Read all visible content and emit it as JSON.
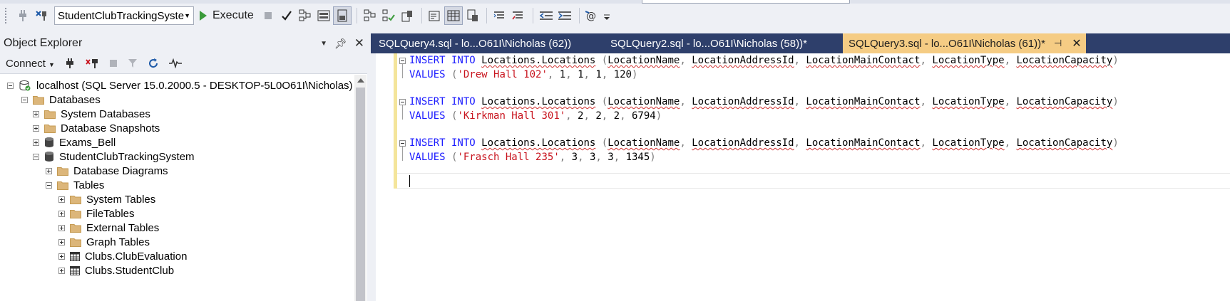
{
  "toolbar": {
    "database_selected": "StudentClubTrackingSystem",
    "execute_label": "Execute"
  },
  "object_explorer": {
    "title": "Object Explorer",
    "connect_label": "Connect",
    "tree": [
      {
        "label": "localhost (SQL Server 15.0.2000.5 - DESKTOP-5L0O61I\\Nicholas)",
        "icon": "server-icon",
        "expander": "minus"
      },
      {
        "label": "Databases",
        "icon": "folder-icon",
        "expander": "minus"
      },
      {
        "label": "System Databases",
        "icon": "folder-icon",
        "expander": "plus"
      },
      {
        "label": "Database Snapshots",
        "icon": "folder-icon",
        "expander": "plus"
      },
      {
        "label": "Exams_Bell",
        "icon": "database-icon",
        "expander": "plus"
      },
      {
        "label": "StudentClubTrackingSystem",
        "icon": "database-icon",
        "expander": "minus"
      },
      {
        "label": "Database Diagrams",
        "icon": "folder-icon",
        "expander": "plus"
      },
      {
        "label": "Tables",
        "icon": "folder-icon",
        "expander": "minus"
      },
      {
        "label": "System Tables",
        "icon": "folder-icon",
        "expander": "plus"
      },
      {
        "label": "FileTables",
        "icon": "folder-icon",
        "expander": "plus"
      },
      {
        "label": "External Tables",
        "icon": "folder-icon",
        "expander": "plus"
      },
      {
        "label": "Graph Tables",
        "icon": "folder-icon",
        "expander": "plus"
      },
      {
        "label": "Clubs.ClubEvaluation",
        "icon": "table-icon",
        "expander": "plus"
      },
      {
        "label": "Clubs.StudentClub",
        "icon": "table-icon",
        "expander": "plus"
      }
    ]
  },
  "tabs": [
    {
      "label": "SQLQuery4.sql - lo...O61I\\Nicholas (62))",
      "active": false
    },
    {
      "label": "SQLQuery2.sql - lo...O61I\\Nicholas (58))*",
      "active": false
    },
    {
      "label": "SQLQuery3.sql - lo...O61I\\Nicholas (61))*",
      "active": true
    }
  ],
  "editor": {
    "statements": [
      {
        "insert_kw": "INSERT INTO",
        "table": "Locations.Locations",
        "columns": [
          "LocationName",
          "LocationAddressId",
          "LocationMainContact",
          "LocationType",
          "LocationCapacity"
        ],
        "values_kw": "VALUES",
        "name_value": "'Drew Hall 102'",
        "nums": [
          "1",
          "1",
          "1",
          "120"
        ]
      },
      {
        "insert_kw": "INSERT INTO",
        "table": "Locations.Locations",
        "columns": [
          "LocationName",
          "LocationAddressId",
          "LocationMainContact",
          "LocationType",
          "LocationCapacity"
        ],
        "values_kw": "VALUES",
        "name_value": "'Kirkman Hall 301'",
        "nums": [
          "2",
          "2",
          "2",
          "6794"
        ]
      },
      {
        "insert_kw": "INSERT INTO",
        "table": "Locations.Locations",
        "columns": [
          "LocationName",
          "LocationAddressId",
          "LocationMainContact",
          "LocationType",
          "LocationCapacity"
        ],
        "values_kw": "VALUES",
        "name_value": "'Frasch Hall 235'",
        "nums": [
          "3",
          "3",
          "3",
          "1345"
        ]
      }
    ]
  }
}
